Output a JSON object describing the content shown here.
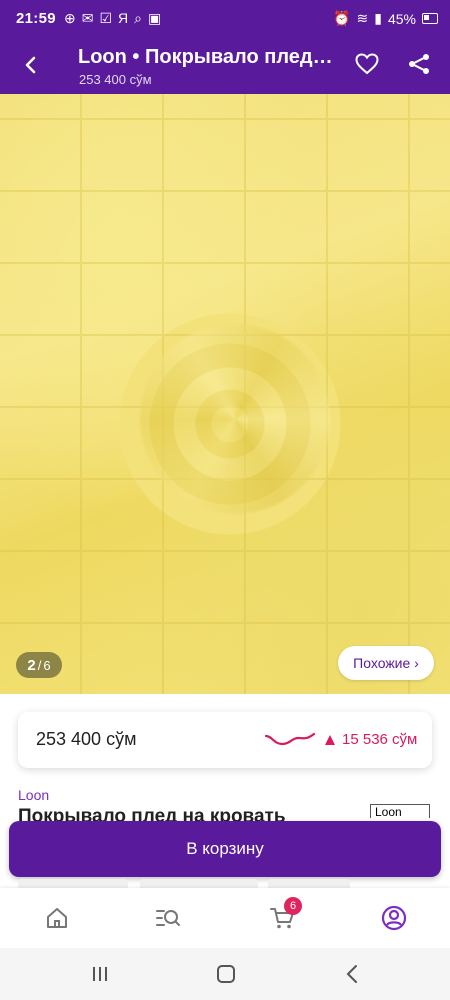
{
  "status_bar": {
    "time": "21:59",
    "battery": "45%"
  },
  "header": {
    "title": "Loon • Покрывало плед на кровать",
    "price": "253 400 сўм"
  },
  "gallery": {
    "current": "2",
    "separator": "/",
    "total": "6",
    "similar_label": "Похожие ›"
  },
  "price_card": {
    "price": "253 400 сўм",
    "delta": "15 536 сўм",
    "delta_color": "#d81b60"
  },
  "product": {
    "brand": "Loon",
    "name": "Покрывало плед на кровать",
    "logo_text": "Loon"
  },
  "cart_button": {
    "label": "В корзину"
  },
  "bottom_nav": {
    "cart_badge": "6",
    "active_color": "#7b2fc2"
  },
  "colors": {
    "brand": "#5a1a9c",
    "accent": "#7b2fc2"
  }
}
